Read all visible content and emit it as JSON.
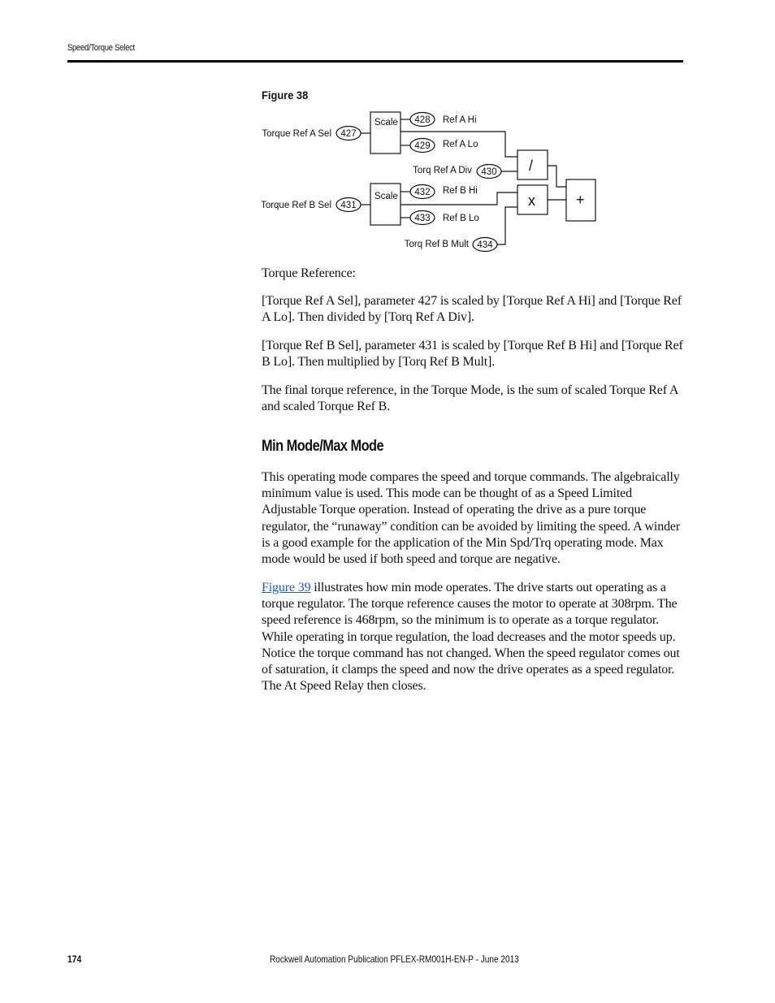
{
  "header": {
    "section_title": "Speed/Torque Select"
  },
  "figure": {
    "title": "Figure 38",
    "blocks": {
      "scale_a": "Scale",
      "scale_b": "Scale",
      "divide": "/",
      "multiply": "x",
      "sum": "+"
    },
    "inputs": {
      "a_sel": {
        "label": "Torque Ref A Sel",
        "param": "427"
      },
      "a_hi": {
        "label": "Ref A Hi",
        "param": "428"
      },
      "a_lo": {
        "label": "Ref A Lo",
        "param": "429"
      },
      "a_div": {
        "label": "Torq Ref A Div",
        "param": "430"
      },
      "b_sel": {
        "label": "Torque Ref B Sel",
        "param": "431"
      },
      "b_hi": {
        "label": "Ref B Hi",
        "param": "432"
      },
      "b_lo": {
        "label": "Ref B Lo",
        "param": "433"
      },
      "b_mult": {
        "label": "Torq Ref B Mult",
        "param": "434"
      }
    }
  },
  "content": {
    "p1": "Torque Reference:",
    "p2": "[Torque Ref A Sel], parameter 427 is scaled by [Torque Ref A Hi] and [Torque Ref A Lo]. Then divided by [Torq Ref A Div].",
    "p3": "[Torque Ref B Sel], parameter 431 is scaled by [Torque Ref B Hi] and [Torque Ref B Lo]. Then multiplied by [Torq Ref B Mult].",
    "p4": "The final torque reference, in the Torque Mode, is the sum of scaled Torque Ref A and scaled Torque Ref B.",
    "section_heading": "Min Mode/Max Mode",
    "p5": "This operating mode compares the speed and torque commands. The algebraically minimum value is used. This mode can be thought of as a Speed Limited Adjustable Torque operation. Instead of operating the drive as a pure torque regulator, the “runaway” condition can be avoided by limiting the speed. A winder is a good example for the application of the Min Spd/Trq operating mode. Max mode would be used if both speed and torque are negative.",
    "p6_link": "Figure 39",
    "p6_rest": " illustrates how min mode operates. The drive starts out operating as a torque regulator. The torque reference causes the motor to operate at 308rpm. The speed reference is 468rpm, so the minimum is to operate as a torque regulator. While operating in torque regulation, the load decreases and the motor speeds up. Notice the torque command has not changed. When the speed regulator comes out of saturation, it clamps the speed and now the drive operates as a speed regulator. The At Speed Relay then closes.",
    "link_color": "#1a5bd6"
  },
  "footer": {
    "page_number": "174",
    "publication": "Rockwell Automation Publication PFLEX-RM001H-EN-P - June 2013"
  }
}
